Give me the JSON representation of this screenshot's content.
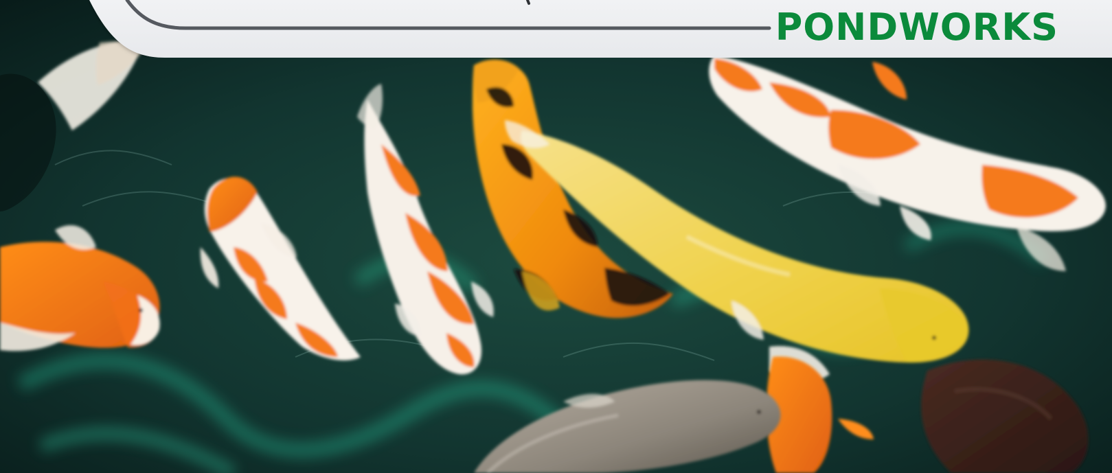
{
  "brand": {
    "name": "PONDWORKS",
    "color": "#0b8a3b"
  },
  "header": {
    "background": "#e9ebee",
    "line_color": "#55595f"
  },
  "hero": {
    "subject": "koi-pond-photo"
  }
}
